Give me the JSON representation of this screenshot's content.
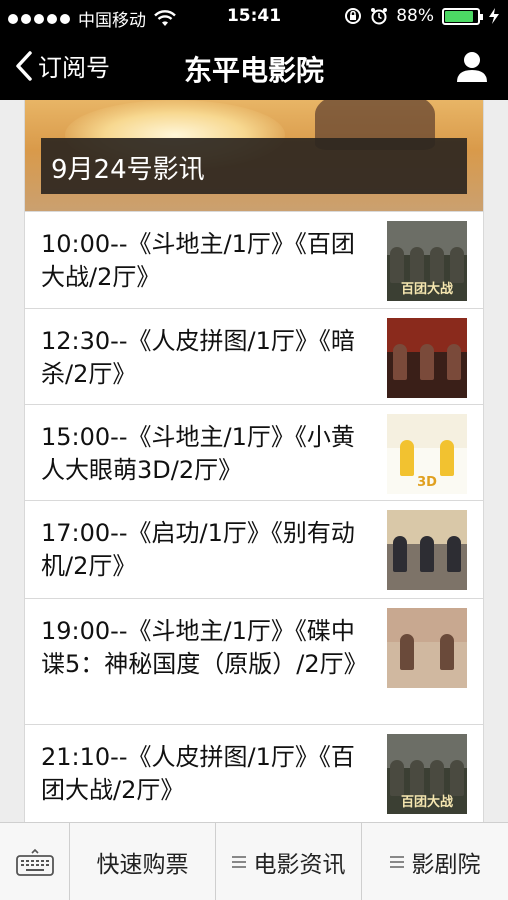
{
  "status_bar": {
    "carrier": "中国移动",
    "time": "15:41",
    "battery": "88%",
    "battery_level": 0.88
  },
  "nav": {
    "back_label": "订阅号",
    "title": "东平电影院"
  },
  "banner": {
    "caption": "9月24号影讯"
  },
  "films": [
    {
      "text": "10:00--《斗地主/1厅》《百团大战/2厅》",
      "thumb_title": "百团大战",
      "thumb_sky": "#6c6e66",
      "thumb_bg": "#3b3f33",
      "people": "#4a4a40"
    },
    {
      "text": "12:30--《人皮拼图/1厅》《暗杀/2厅》",
      "thumb_title": "",
      "thumb_sky": "#8a2a1c",
      "thumb_bg": "#3a1f18",
      "people": "#7a4a3a"
    },
    {
      "text": "15:00--《斗地主/1厅》《小黄人大眼萌3D/2厅》",
      "thumb_title": "3D",
      "thumb_sky": "#f5f0e0",
      "thumb_bg": "#fbfaf3",
      "people": "#f2c230"
    },
    {
      "text": "17:00--《启功/1厅》《别有动机/2厅》",
      "thumb_title": "",
      "thumb_sky": "#d9c8a8",
      "thumb_bg": "#7d7368",
      "people": "#2d2d33"
    },
    {
      "text": "19:00--《斗地主/1厅》《碟中谍5：神秘国度（原版）/2厅》",
      "thumb_title": "",
      "thumb_sky": "#c8a890",
      "thumb_bg": "#d0b8a0",
      "people": "#6a4a3a"
    },
    {
      "text": "21:10--《人皮拼图/1厅》《百团大战/2厅》",
      "thumb_title": "百团大战",
      "thumb_sky": "#6c6e66",
      "thumb_bg": "#3b3f33",
      "people": "#4a4a40"
    }
  ],
  "tabs": [
    {
      "label": "快速购票",
      "has_menu_icon": false
    },
    {
      "label": "电影资讯",
      "has_menu_icon": true
    },
    {
      "label": "影剧院",
      "has_menu_icon": true
    }
  ],
  "icons": {
    "back": "chevron-left-icon",
    "profile": "user-icon",
    "keyboard": "keyboard-icon",
    "menu": "menu-lines-icon"
  },
  "colors": {
    "nav_bg": "#000000",
    "battery_green": "#4cd964",
    "tab_bg": "#f7f7f7"
  }
}
